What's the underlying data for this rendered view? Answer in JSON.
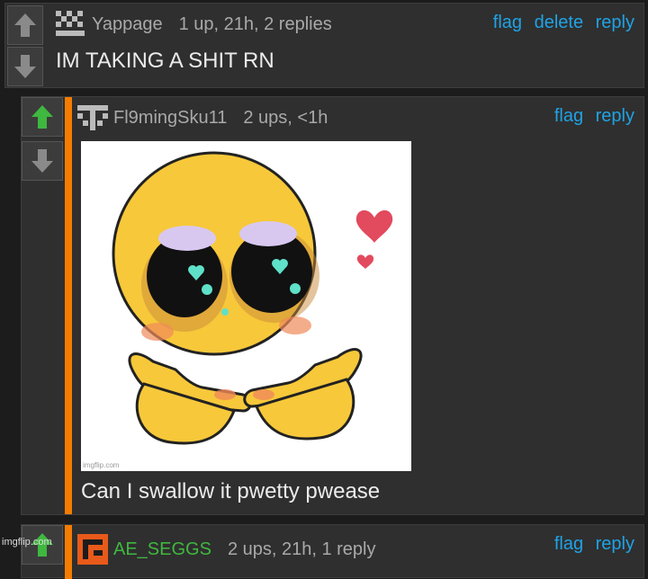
{
  "comments": [
    {
      "username": "Yappage",
      "meta": "1 up, 21h, 2 replies",
      "actions": [
        "flag",
        "delete",
        "reply"
      ],
      "text": "IM TAKING A SHIT RN"
    },
    {
      "username": "Fl9mingSku11",
      "meta": "2 ups, <1h",
      "actions": [
        "flag",
        "reply"
      ],
      "image_watermark": "imgflip.com",
      "text": "Can I swallow it pwetty pwease"
    },
    {
      "username": "AE_SEGGS",
      "meta": "2 ups, 21h, 1 reply",
      "actions": [
        "flag",
        "reply"
      ]
    }
  ],
  "site_watermark": "imgflip.com",
  "colors": {
    "upvoted": "#3fb83f",
    "accent": "#f57c00",
    "link": "#1fa3e6"
  }
}
